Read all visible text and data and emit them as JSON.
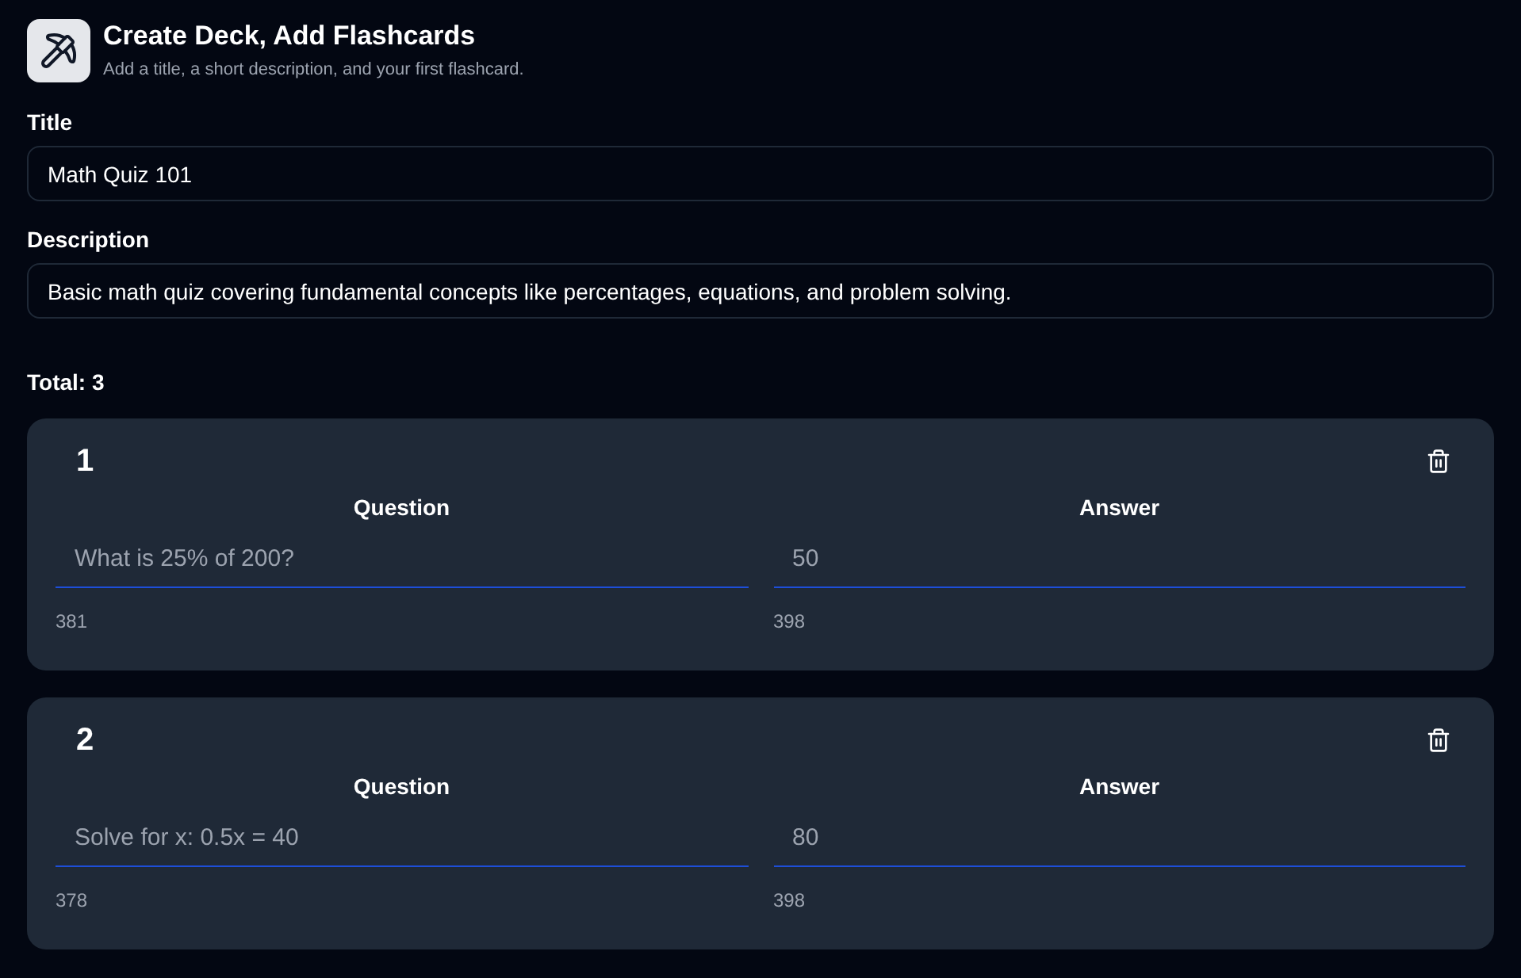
{
  "header": {
    "title": "Create Deck, Add Flashcards",
    "subtitle": "Add a title, a short description, and your first flashcard."
  },
  "fields": [
    {
      "label": "Title",
      "value": "Math Quiz 101"
    },
    {
      "label": "Description",
      "value": "Basic math quiz covering fundamental concepts like percentages, equations, and problem solving."
    }
  ],
  "total": "Total: 3",
  "cards": [
    {
      "number": "1",
      "question": {
        "label": "Question",
        "value": "What is 25% of 200?",
        "counter": "381"
      },
      "answer": {
        "label": "Answer",
        "value": "50",
        "counter": "398"
      }
    },
    {
      "number": "2",
      "question": {
        "label": "Question",
        "value": "Solve for x: 0.5x = 40",
        "counter": "378"
      },
      "answer": {
        "label": "Answer",
        "value": "80",
        "counter": "398"
      }
    }
  ]
}
